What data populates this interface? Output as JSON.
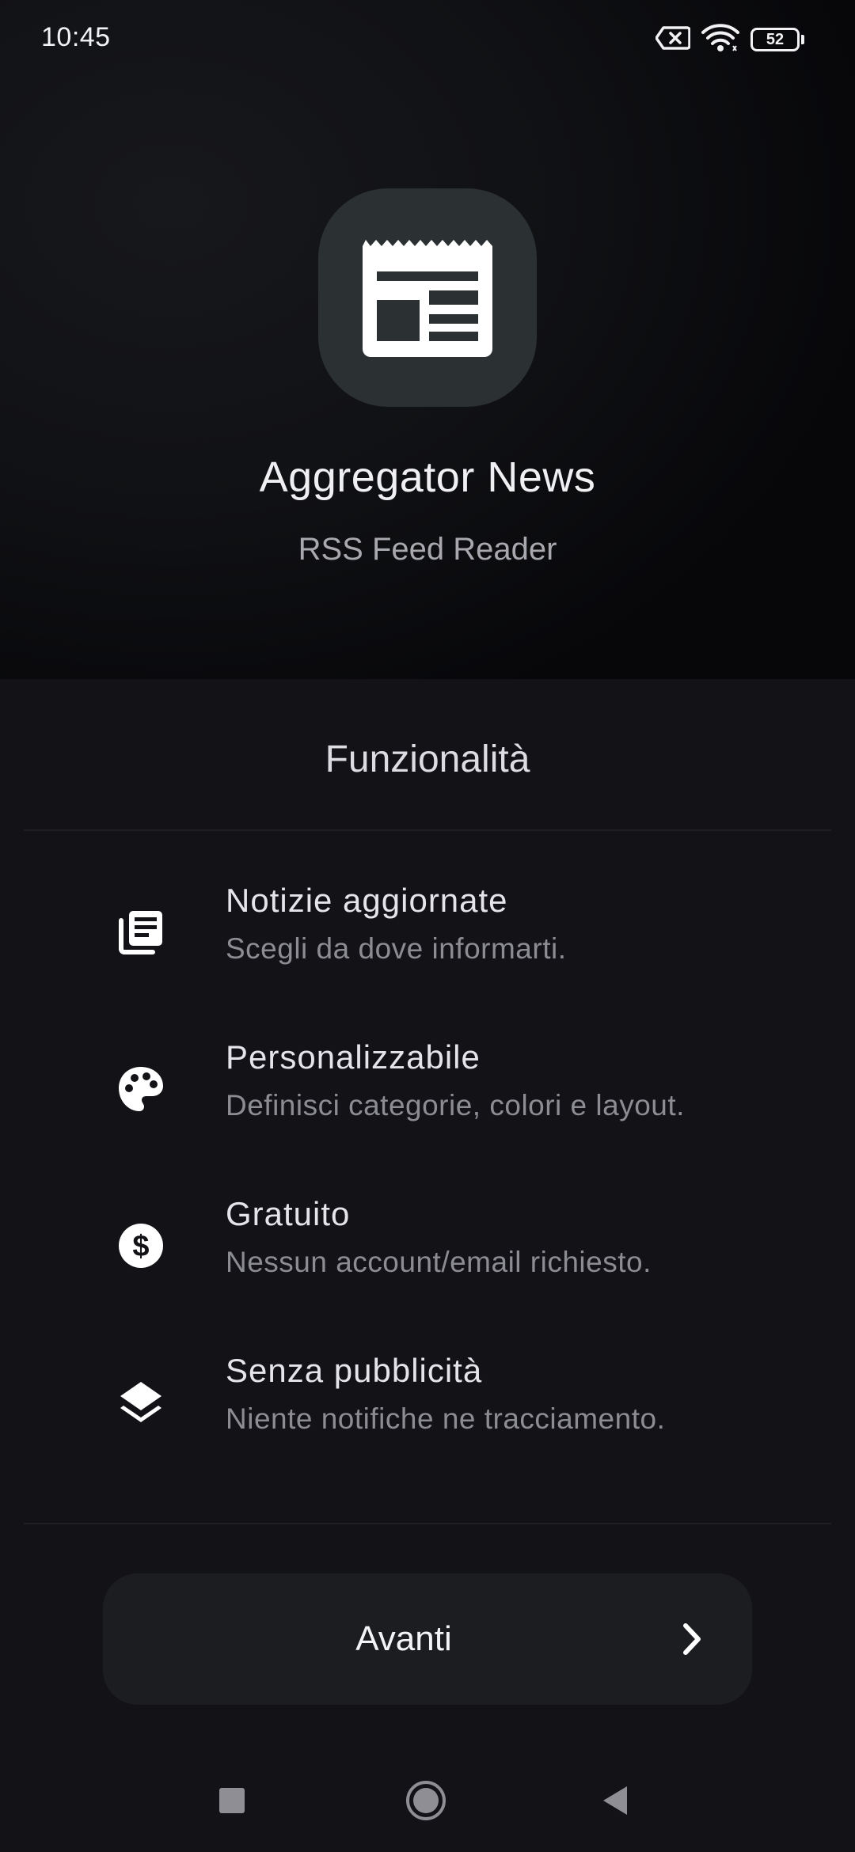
{
  "status_bar": {
    "time": "10:45",
    "battery_level": "52",
    "icons": [
      "no-sim-icon",
      "wifi-icon",
      "battery-icon"
    ]
  },
  "app": {
    "icon": "newspaper-icon",
    "title": "Aggregator News",
    "subtitle": "RSS Feed Reader"
  },
  "features": {
    "heading": "Funzionalità",
    "items": [
      {
        "icon": "news-list-icon",
        "title": "Notizie aggiornate",
        "description": "Scegli da dove informarti."
      },
      {
        "icon": "palette-icon",
        "title": "Personalizzabile",
        "description": "Definisci categorie, colori e layout."
      },
      {
        "icon": "dollar-icon",
        "title": "Gratuito",
        "description": "Nessun account/email richiesto."
      },
      {
        "icon": "layers-icon",
        "title": "Senza pubblicità",
        "description": "Niente notifiche ne tracciamento."
      }
    ]
  },
  "next_button": {
    "label": "Avanti",
    "icon": "chevron-right-icon"
  },
  "nav_bar": {
    "buttons": [
      "recents-square-icon",
      "home-circle-icon",
      "back-triangle-icon"
    ]
  },
  "colors": {
    "background": "#131317",
    "icon_tile": "#2b3033",
    "button": "#1c1d21",
    "text_primary": "#e4e4ea",
    "text_secondary": "#8c8c93"
  }
}
